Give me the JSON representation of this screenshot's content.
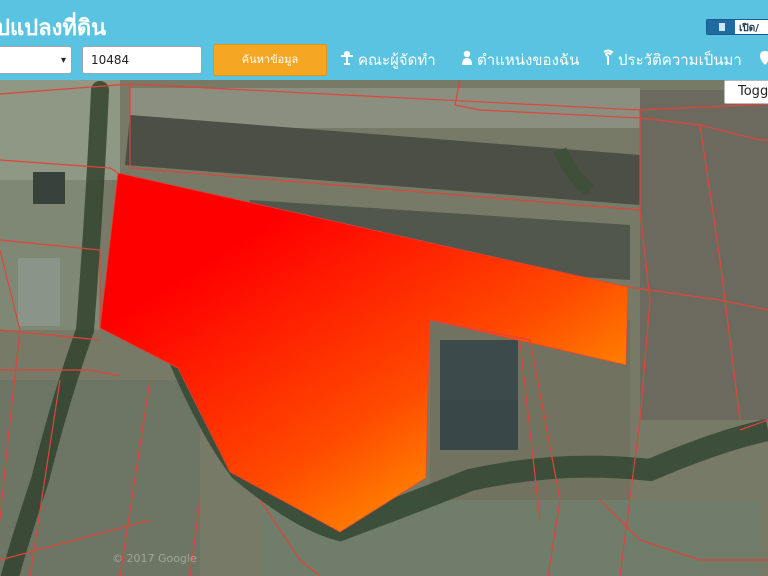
{
  "header": {
    "title": "ปแปลงที่ดิน",
    "open_toggle_label": "เปิด/",
    "province_select": {
      "value": "",
      "caret": "▾"
    },
    "deed_input": {
      "value": "10484"
    },
    "search_button_label": "ค้นหาข้อมูล",
    "nav": [
      {
        "label": "คณะผู้จัดทำ",
        "icon": "person-pin-icon"
      },
      {
        "label": "ตำแหน่งของฉัน",
        "icon": "person-icon"
      },
      {
        "label": "ประวัติความเป็นมา",
        "icon": "history-icon"
      }
    ]
  },
  "map": {
    "toggle_label": "Togg",
    "watermark": "© 2017 Google",
    "highlight_gradient": [
      "#ff0000",
      "#ff6a00",
      "#ffb000"
    ],
    "boundary_color": "#e0443a"
  }
}
